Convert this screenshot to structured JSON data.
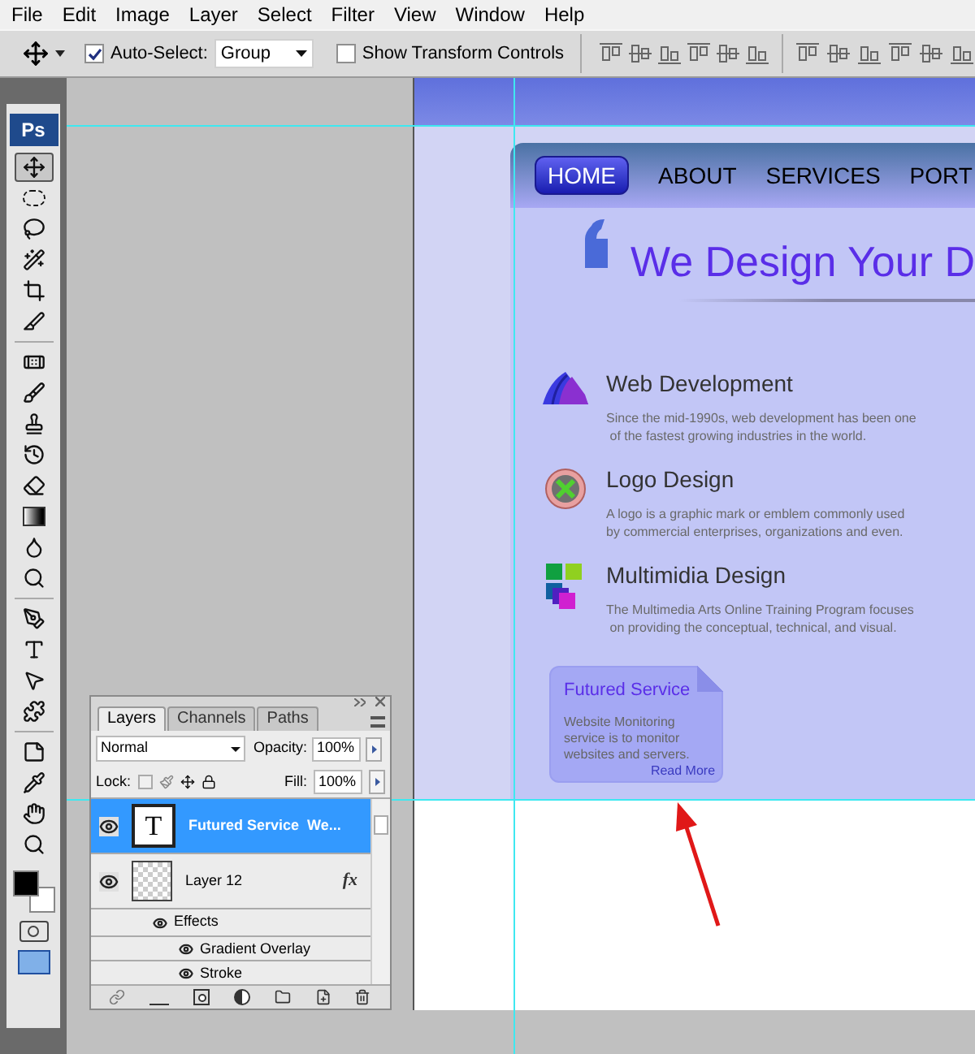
{
  "menu": [
    "File",
    "Edit",
    "Image",
    "Layer",
    "Select",
    "Filter",
    "View",
    "Window",
    "Help"
  ],
  "options": {
    "auto_select": {
      "label": "Auto-Select:",
      "checked": true,
      "value": "Group"
    },
    "show_transform": {
      "label": "Show Transform Controls",
      "checked": false
    }
  },
  "toolbox": {
    "logo": "Ps",
    "tools": [
      {
        "selected": true
      },
      {
        "selected": false
      },
      {
        "selected": false
      },
      {
        "selected": false
      },
      {
        "selected": false
      },
      {
        "selected": false
      },
      {
        "selected": false
      },
      {
        "selected": false
      },
      {
        "selected": false
      },
      {
        "selected": false
      },
      {
        "selected": false
      },
      {
        "selected": false
      },
      {
        "selected": false
      },
      {
        "selected": false
      },
      {
        "selected": false
      },
      {
        "selected": false
      },
      {
        "selected": false
      },
      {
        "selected": false
      },
      {
        "selected": false
      },
      {
        "selected": false
      },
      {
        "selected": false
      },
      {
        "selected": false
      }
    ]
  },
  "document": {
    "nav": [
      {
        "label": "HOME",
        "selected": true
      },
      {
        "label": "ABOUT",
        "selected": false
      },
      {
        "label": "SERVICES",
        "selected": false
      },
      {
        "label": "PORT",
        "selected": false
      }
    ],
    "heading": "We Design Your D",
    "services": [
      {
        "kind": "web",
        "title": "Web Development",
        "description": "Since the mid-1990s, web development has been one\n of the fastest growing industries in the world."
      },
      {
        "kind": "logo",
        "title": "Logo Design",
        "description": "A logo is a graphic mark or emblem commonly used\nby commercial enterprises, organizations and even."
      },
      {
        "kind": "media",
        "title": "Multimidia Design",
        "description": "The Multimedia Arts Online Training Program focuses\n on providing the conceptual, technical, and visual."
      }
    ],
    "featured": {
      "title": "Futured Service",
      "text": "Website Monitoring service is to monitor websites and servers.",
      "link": "Read More"
    }
  },
  "layers_panel": {
    "tabs": [
      {
        "label": "Layers",
        "selected": true
      },
      {
        "label": "Channels",
        "selected": false
      },
      {
        "label": "Paths",
        "selected": false
      }
    ],
    "blend_mode": "Normal",
    "opacity_label": "Opacity:",
    "opacity": "100%",
    "lock_label": "Lock:",
    "fill_label": "Fill:",
    "fill": "100%",
    "layers": [
      {
        "kind": "text",
        "thumb": "T",
        "name": "Futured Service  We...",
        "selected": true,
        "visible": true
      },
      {
        "kind": "image",
        "name": "Layer 12",
        "badge": "fx",
        "selected": false,
        "visible": true,
        "children": [
          {
            "name": "Effects",
            "children": [
              {
                "name": "Gradient Overlay"
              },
              {
                "name": "Stroke"
              }
            ]
          }
        ]
      }
    ]
  }
}
